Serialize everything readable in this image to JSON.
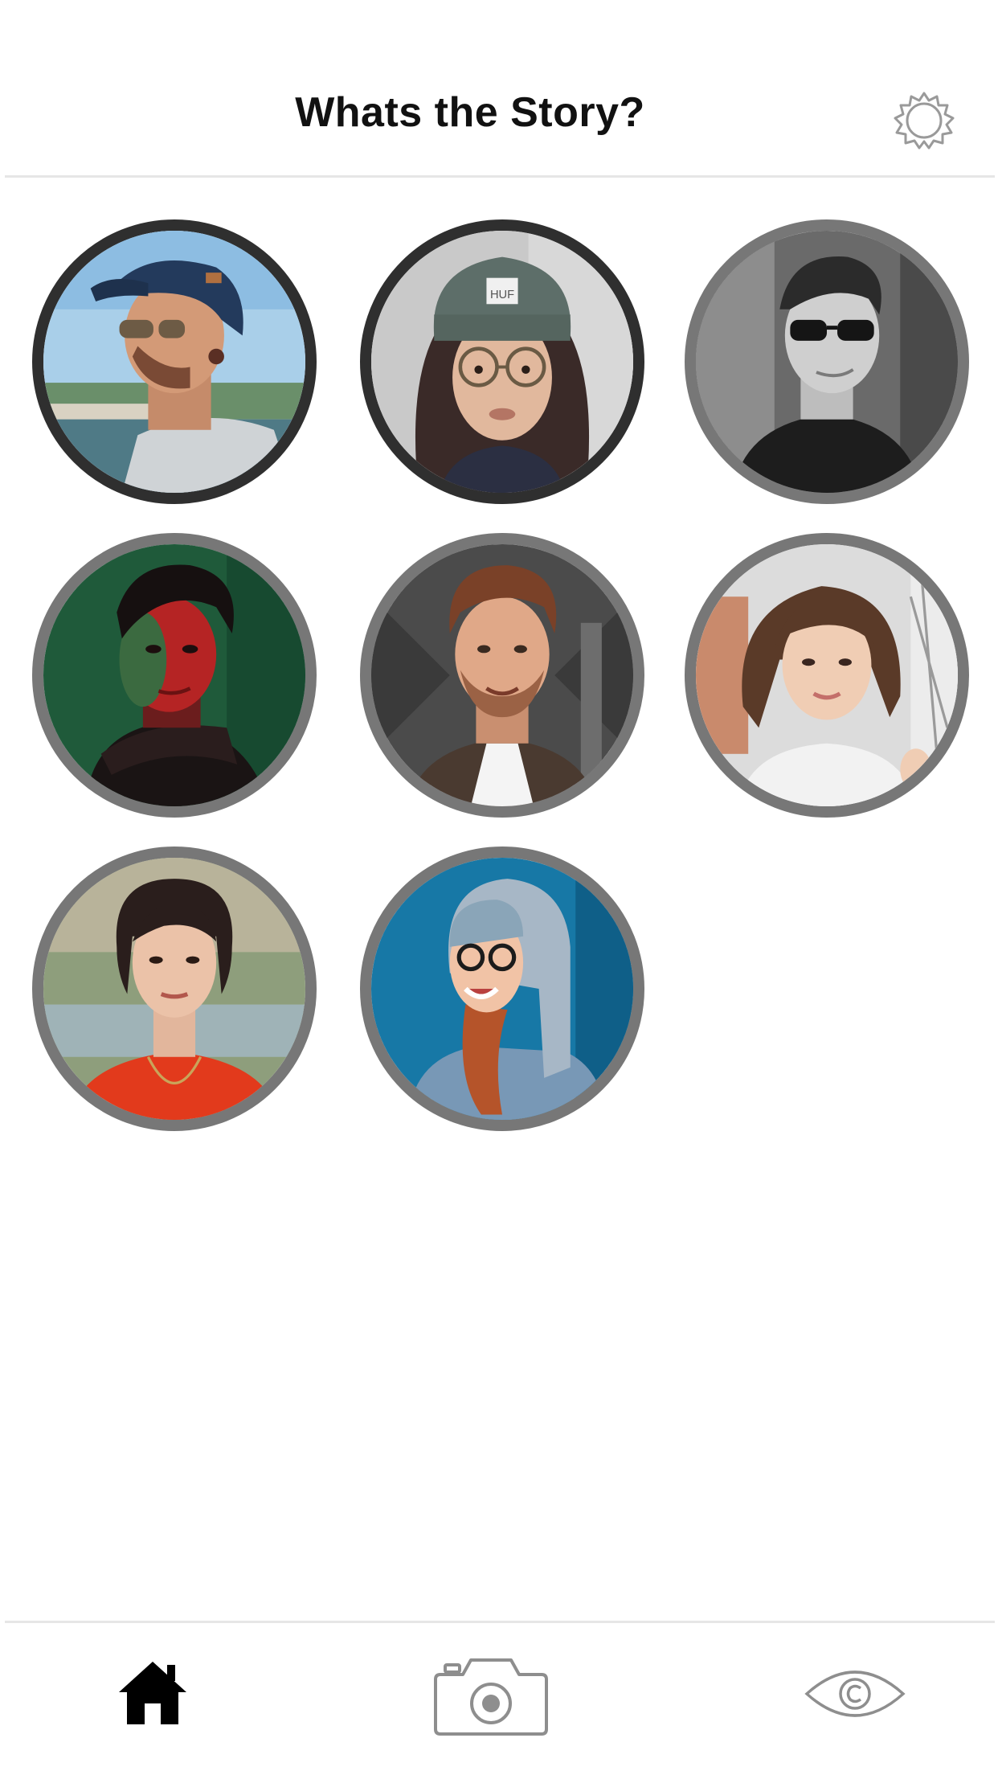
{
  "header": {
    "title": "Whats the Story?",
    "settings_icon": "gear-icon"
  },
  "stories": [
    {
      "name": "story-avatar-1",
      "ring": "#2f2f2f",
      "seen": false
    },
    {
      "name": "story-avatar-2",
      "ring": "#2f2f2f",
      "seen": false
    },
    {
      "name": "story-avatar-3",
      "ring": "#777777",
      "seen": true
    },
    {
      "name": "story-avatar-4",
      "ring": "#777777",
      "seen": true
    },
    {
      "name": "story-avatar-5",
      "ring": "#777777",
      "seen": true
    },
    {
      "name": "story-avatar-6",
      "ring": "#777777",
      "seen": true
    },
    {
      "name": "story-avatar-7",
      "ring": "#777777",
      "seen": true
    },
    {
      "name": "story-avatar-8",
      "ring": "#777777",
      "seen": true
    }
  ],
  "avatar_text": {
    "beanie_logo": "HUF"
  },
  "tabbar": {
    "items": [
      {
        "icon": "home-icon",
        "active": true
      },
      {
        "icon": "camera-icon",
        "active": false
      },
      {
        "icon": "eye-icon",
        "active": false
      }
    ]
  },
  "colors": {
    "unseen_ring": "#2f2f2f",
    "seen_ring": "#777777",
    "active_tab": "#000000",
    "inactive_tab": "#8e8e8e",
    "divider": "#e6e6e6"
  }
}
